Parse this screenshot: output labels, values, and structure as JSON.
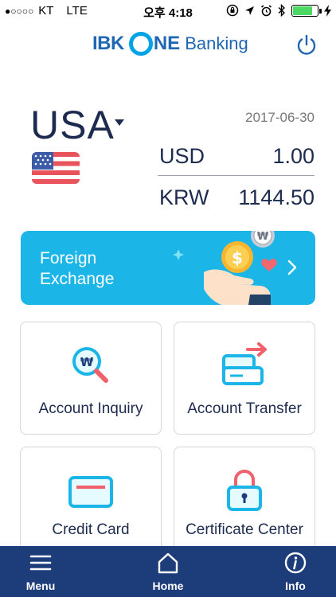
{
  "status_bar": {
    "signal": "●○○○○",
    "carrier": "KT",
    "network": "LTE",
    "time": "오후 4:18",
    "battery_level_pct": 80,
    "icons": [
      "lock-rotation-icon",
      "location-icon",
      "alarm-icon",
      "bluetooth-icon",
      "battery-icon",
      "charging-icon"
    ]
  },
  "header": {
    "logo_ibk": "IBK",
    "logo_ne": "NE",
    "logo_banking": "Banking",
    "power_icon": "power-icon"
  },
  "currency": {
    "country": "USA",
    "date": "2017-06-30",
    "rates": [
      {
        "code": "USD",
        "value": "1.00"
      },
      {
        "code": "KRW",
        "value": "1144.50"
      }
    ]
  },
  "banner": {
    "title_line1": "Foreign",
    "title_line2": "Exchange",
    "won_badge": "₩"
  },
  "menu": [
    {
      "label": "Account Inquiry",
      "icon": "magnifier-won-icon"
    },
    {
      "label": "Account Transfer",
      "icon": "transfer-card-icon"
    },
    {
      "label": "Credit Card",
      "icon": "credit-card-icon"
    },
    {
      "label": "Certificate Center",
      "icon": "padlock-icon"
    }
  ],
  "magnifier_symbol": "₩",
  "tabbar": {
    "menu": "Menu",
    "home": "Home",
    "info": "Info"
  },
  "colors": {
    "brand_blue": "#1f66b3",
    "accent_cyan": "#1cb5e8",
    "tabbar": "#1d3d7a",
    "accent_red": "#f0616b"
  }
}
